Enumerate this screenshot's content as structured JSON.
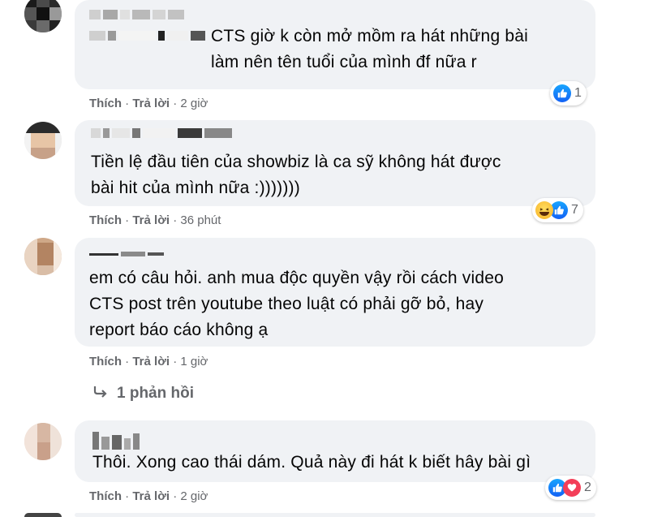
{
  "comments": [
    {
      "text": "CTS giờ k còn mở mồm ra hát những bài\nlàm nên tên tuổi của mình đf nữa r",
      "actions": {
        "like": "Thích",
        "reply": "Trả lời",
        "separator": " · ",
        "time": "2 giờ"
      },
      "reactions": {
        "icons": [
          "like-icon"
        ],
        "count": "1"
      }
    },
    {
      "text": "Tiền lệ đầu tiên của showbiz là ca sỹ không hát được\nbài hit của mình nữa :)))))))",
      "actions": {
        "like": "Thích",
        "reply": "Trả lời",
        "separator": " · ",
        "time": "36 phút"
      },
      "reactions": {
        "icons": [
          "haha-icon",
          "like-icon"
        ],
        "count": "7"
      }
    },
    {
      "text": "em có câu hỏi. anh mua độc quyền vậy rồi cách video\nCTS post trên youtube theo luật có phải gỡ bỏ, hay\nreport báo cáo không ạ",
      "actions": {
        "like": "Thích",
        "reply": "Trả lời",
        "separator": " · ",
        "time": "1 giờ"
      },
      "replies_label": "1 phản hồi"
    },
    {
      "text": "Thôi. Xong cao thái dám. Quả này đi hát k biết hây bài gì",
      "actions": {
        "like": "Thích",
        "reply": "Trả lời",
        "separator": " · ",
        "time": "2 giờ"
      },
      "reactions": {
        "icons": [
          "like-icon",
          "heart-icon"
        ],
        "count": "2"
      }
    }
  ],
  "colors": {
    "bubble": "#f0f2f5",
    "meta": "#65676b",
    "like_blue": "#1877f2"
  }
}
